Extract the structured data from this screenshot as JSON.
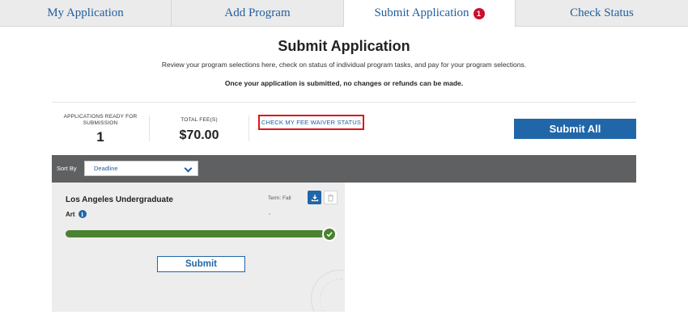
{
  "tabs": [
    {
      "label": "My Application",
      "active": false
    },
    {
      "label": "Add Program",
      "active": false
    },
    {
      "label": "Submit Application",
      "active": true,
      "badge": "1"
    },
    {
      "label": "Check Status",
      "active": false
    }
  ],
  "header": {
    "title": "Submit Application",
    "intro": "Review your program selections here, check on status of individual program tasks, and pay for your program selections.",
    "warning": "Once your application is submitted, no changes or refunds can be made."
  },
  "summary": {
    "ready_label": "APPLICATIONS READY FOR SUBMISSION",
    "ready_value": "1",
    "fee_label": "TOTAL FEE(S)",
    "fee_value": "$70.00",
    "fee_waiver_link": "CHECK MY FEE WAIVER STATUS",
    "submit_all_label": "Submit All"
  },
  "sort": {
    "label": "Sort By",
    "selected": "Deadline"
  },
  "program_card": {
    "name": "Los Angeles Undergraduate",
    "subject": "Art",
    "term": "Term: Fall",
    "progress": 1.0,
    "submit_label": "Submit"
  },
  "colors": {
    "accent": "#2166a8",
    "badge": "#c8102e",
    "progress": "#4a8132",
    "highlight": "#e0131b",
    "sortbar": "#5f6062"
  },
  "icons": {
    "download": "download-icon",
    "delete": "trash-icon",
    "info": "info-icon",
    "complete": "checkmark-icon",
    "dropdown": "chevron-down-icon"
  }
}
